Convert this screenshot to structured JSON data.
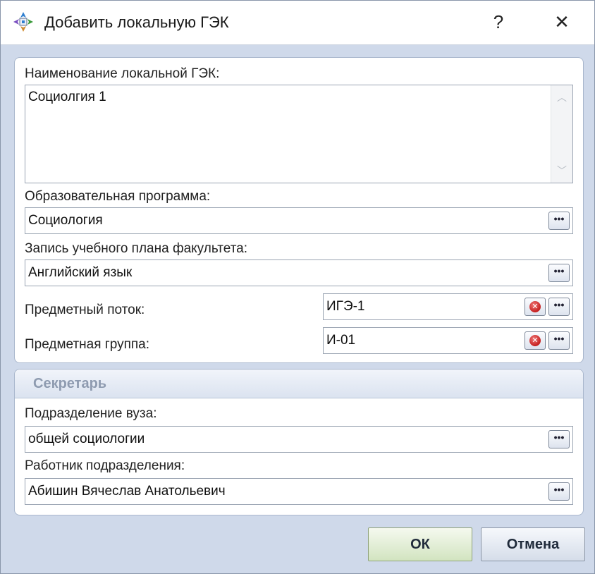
{
  "window": {
    "title": "Добавить локальную ГЭК",
    "help_label": "?",
    "close_label": "✕"
  },
  "main": {
    "name_label": "Наименование локальной ГЭК:",
    "name_value": "Социолгия 1",
    "program_label": "Образовательная программа:",
    "program_value": "Социология",
    "plan_label": "Запись учебного плана факультета:",
    "plan_value": "Английский язык",
    "stream_label": "Предметный поток:",
    "stream_value": "ИГЭ-1",
    "group_label": "Предметная группа:",
    "group_value": "И-01"
  },
  "secretary": {
    "title": "Секретарь",
    "dept_label": "Подразделение вуза:",
    "dept_value": "общей социологии",
    "employee_label": "Работник подразделения:",
    "employee_value": "Абишин Вячеслав Анатольевич"
  },
  "buttons": {
    "ok_label": "ОК",
    "cancel_label": "Отмена",
    "ellipsis_label": "•••",
    "clear_label": "✕"
  },
  "icons": {
    "app": "app-icon",
    "ellipsis": "ellipsis-icon",
    "clear": "clear-icon",
    "scroll_up": "scroll-up-icon",
    "scroll_down": "scroll-down-icon"
  },
  "colors": {
    "window_bg": "#cfd9ea",
    "ok_bg": "#d2e4c0",
    "clear_red": "#c51f1f",
    "group_title": "#8e9bb0"
  }
}
